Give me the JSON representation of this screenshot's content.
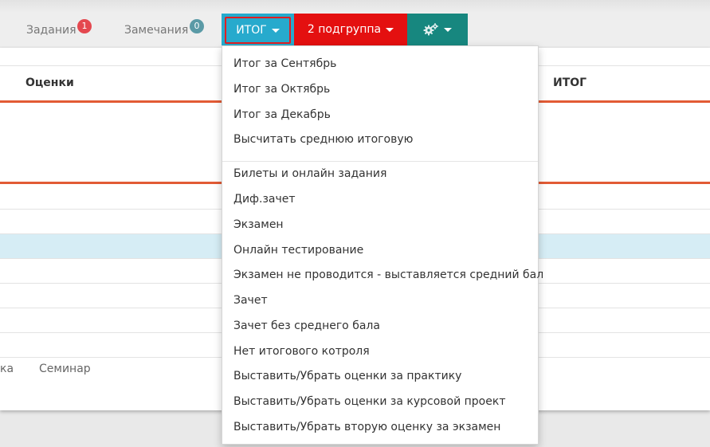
{
  "nav": {
    "tasks": {
      "label": "Задания",
      "badge": "1"
    },
    "remarks": {
      "label": "Замечания",
      "badge": "0"
    },
    "itog_button": "ИТОГ",
    "subgroup_button": "2 подгруппа",
    "settings_icon": "gears-icon"
  },
  "table": {
    "col_grades": "Оценки",
    "col_itog": "ИТОГ"
  },
  "bottom_tabs": [
    "ка",
    "Семинар"
  ],
  "menu": {
    "group1": [
      "Итог за Сентябрь",
      "Итог за Октябрь",
      "Итог за Декабрь",
      "Высчитать среднюю итоговую"
    ],
    "group2": [
      "Билеты и онлайн задания",
      "Диф.зачет",
      "Экзамен",
      "Онлайн тестирование",
      "Экзамен не проводится - выставляется средний бал",
      "Зачет",
      "Зачет без среднего бала",
      "Нет итогового котроля",
      "Выставить/Убрать оценки за практику",
      "Выставить/Убрать оценки за курсовой проект",
      "Выставить/Убрать вторую оценку за экзамен"
    ]
  },
  "colors": {
    "itog_bg": "#27aacd",
    "subgroup_bg": "#e41010",
    "settings_bg": "#17877f",
    "accent_line": "#e25b35",
    "highlight_row": "#d6edf5"
  }
}
